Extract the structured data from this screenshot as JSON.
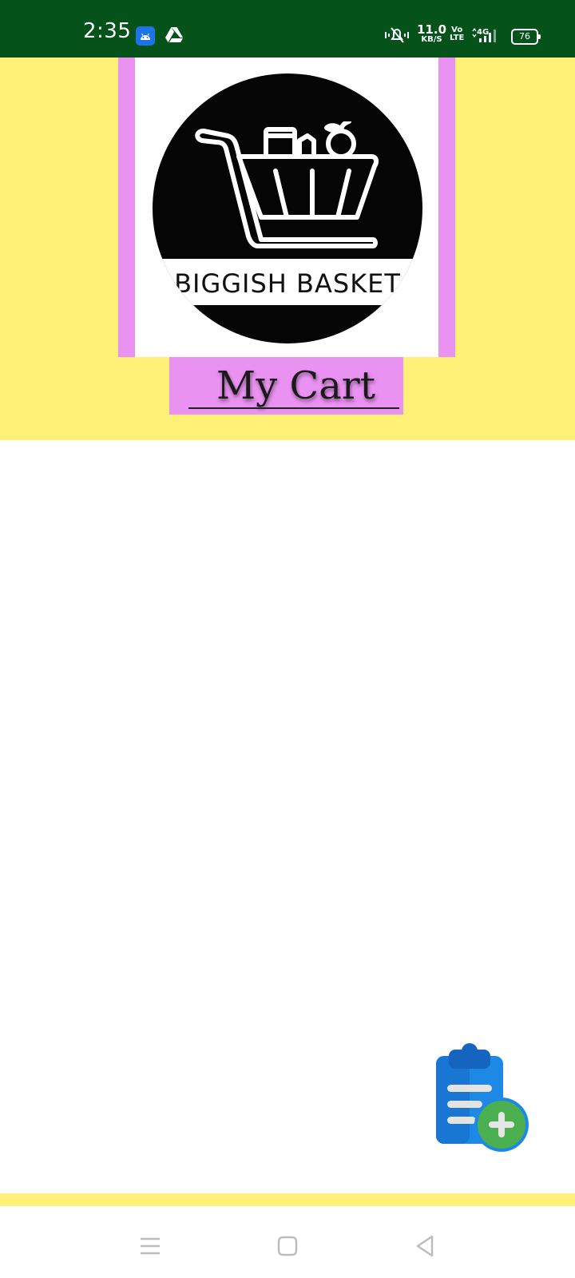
{
  "status_bar": {
    "time": "2:35",
    "net_speed_value": "11.0",
    "net_speed_unit": "KB/S",
    "volte_top": "Vo",
    "volte_bottom": "LTE",
    "network": "4G",
    "battery": "76",
    "icons": [
      "android-notification-icon",
      "drive-icon",
      "vibrate-mute-icon",
      "signal-icon",
      "battery-icon"
    ]
  },
  "logo": {
    "text": "BIGGISH BASKET"
  },
  "header": {
    "title": "My Cart"
  },
  "fab": {
    "icon": "clipboard-add-icon"
  },
  "nav_bar": {
    "icons": [
      "menu-icon",
      "home-icon",
      "back-icon"
    ]
  },
  "colors": {
    "status_bar": "#05521a",
    "header_bg": "#fff077",
    "accent_pink": "#ea92f2",
    "fab_blue": "#1e88e5",
    "fab_green": "#4caf50"
  }
}
